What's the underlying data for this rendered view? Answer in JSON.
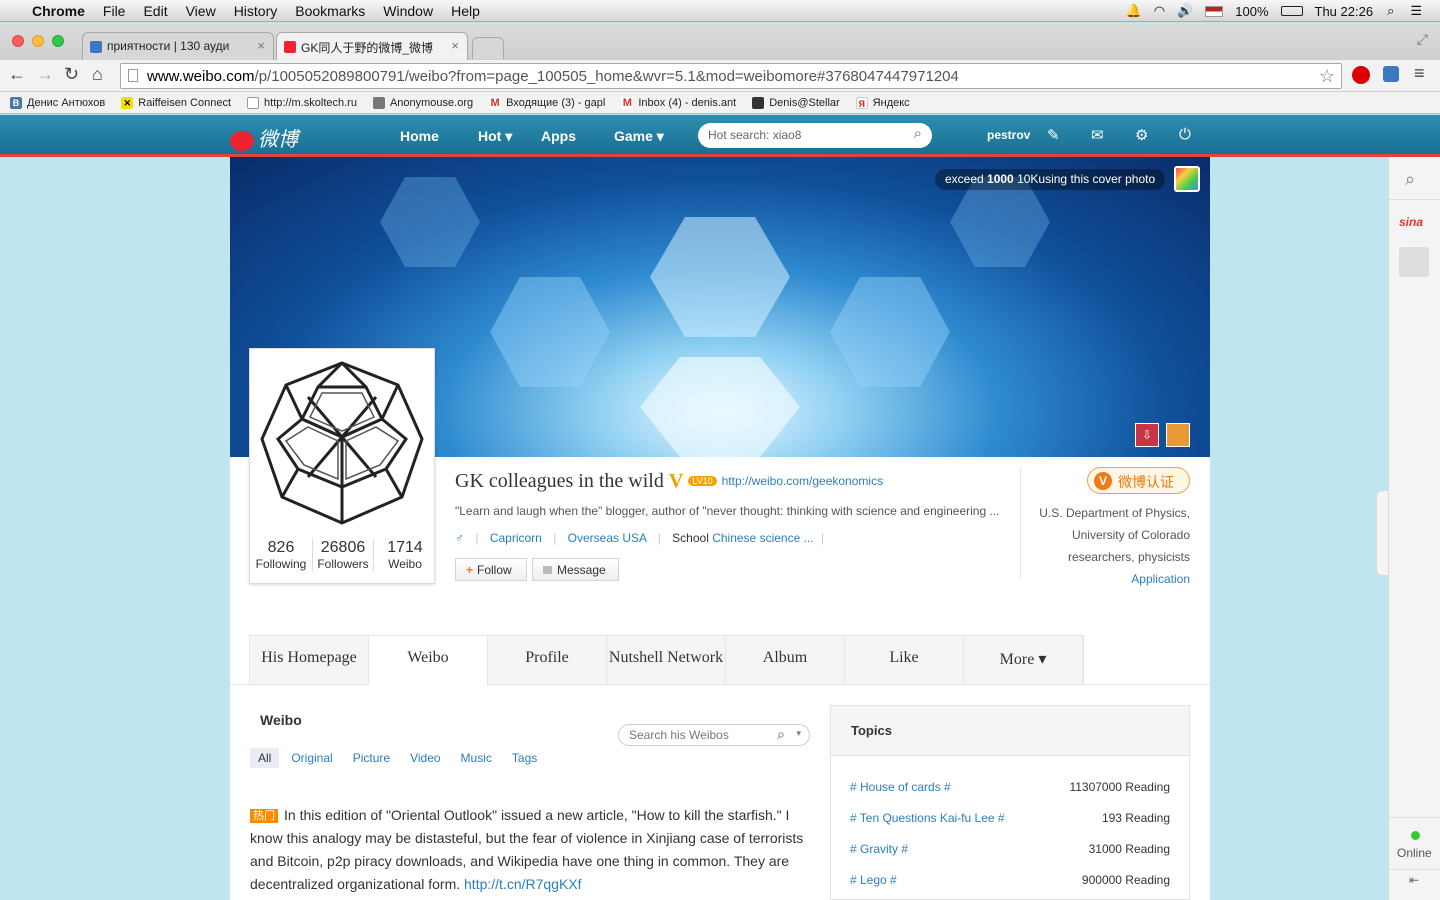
{
  "menubar": {
    "app": "Chrome",
    "menus": [
      "File",
      "Edit",
      "View",
      "History",
      "Bookmarks",
      "Window",
      "Help"
    ],
    "battery": "100%",
    "clock": "Thu 22:26"
  },
  "tabs": [
    {
      "title": "приятности | 130 ауди"
    },
    {
      "title": "GK同人于野的微博_微博"
    }
  ],
  "address": {
    "host": "www.weibo.com",
    "path": "/p/1005052089800791/weibo?from=page_100505_home&wvr=5.1&mod=weibomore#3768047447971204"
  },
  "bookmarks": [
    {
      "label": "Денис Антюхов",
      "icon": "vk-icon",
      "color": "#4a76a8"
    },
    {
      "label": "Raiffeisen Connect",
      "icon": "raiffeisen-icon",
      "color": "#f5e000"
    },
    {
      "label": "http://m.skoltech.ru",
      "icon": "page-icon",
      "color": "#cccccc"
    },
    {
      "label": "Anonymouse.org",
      "icon": "anonymouse-icon",
      "color": "#777777"
    },
    {
      "label": "Входящие (3) - gapl",
      "icon": "gmail-icon",
      "color": "#d93025"
    },
    {
      "label": "Inbox (4) - denis.ant",
      "icon": "gmail-icon",
      "color": "#d93025"
    },
    {
      "label": "Denis@Stellar",
      "icon": "stellar-icon",
      "color": "#333333"
    },
    {
      "label": "Яндекс",
      "icon": "yandex-icon",
      "color": "#e31e24"
    }
  ],
  "weibo_nav": {
    "logo": "微博",
    "links": [
      "Home",
      "Hot ▾",
      "Apps",
      "Game ▾"
    ],
    "search_placeholder": "Hot search: xiao8",
    "user": "pestrov"
  },
  "cover": {
    "notice_pre": "exceed ",
    "notice_count": "1000",
    "notice_post": " 10Kusing this cover photo"
  },
  "profile": {
    "name": "GK colleagues in the wild",
    "vip": "LV10",
    "url": "http://weibo.com/geekonomics",
    "bio": "\"Learn and laugh when the\" blogger, author of \"never thought: thinking with science and engineering ...",
    "gender": "♂",
    "tags": [
      "Capricorn",
      "Overseas USA"
    ],
    "school_label": "School ",
    "school": "Chinese science ...",
    "follow": "Follow",
    "message": "Message",
    "stats": [
      {
        "n": "826",
        "label": "Following"
      },
      {
        "n": "26806",
        "label": "Followers"
      },
      {
        "n": "1714",
        "label": "Weibo"
      }
    ],
    "verify_badge": "微博认证",
    "verify_desc": "U.S. Department of Physics, University of Colorado researchers, physicists",
    "application": "Application"
  },
  "profile_tabs": [
    "His Homepage",
    "Weibo",
    "Profile",
    "Nutshell Network",
    "Album",
    "Like",
    "More ▾"
  ],
  "feed": {
    "title": "Weibo",
    "search_placeholder": "Search his Weibos",
    "filters": [
      "All",
      "Original",
      "Picture",
      "Video",
      "Music",
      "Tags"
    ],
    "post_badge": "热门",
    "post_text": "In this edition of \"Oriental Outlook\" issued a new article, \"How to kill the starfish.\" I know this analogy may be distasteful, but the fear of violence in Xinjiang case of terrorists and Bitcoin, p2p piracy downloads, and Wikipedia have one thing in common. They are decentralized organizational form. ",
    "post_link": "http://t.cn/R7qgKXf"
  },
  "topics": {
    "title": "Topics",
    "items": [
      {
        "name": "# House of cards #",
        "reading": "11307000 Reading"
      },
      {
        "name": "# Ten Questions Kai-fu Lee #",
        "reading": "193 Reading"
      },
      {
        "name": "# Gravity #",
        "reading": "31000 Reading"
      },
      {
        "name": "# Lego #",
        "reading": "900000 Reading"
      }
    ]
  },
  "rail": {
    "online": "Online",
    "sina": "sina"
  }
}
